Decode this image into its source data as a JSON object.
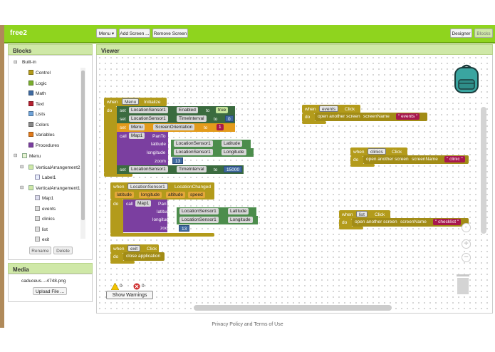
{
  "project": {
    "name": "free2"
  },
  "toolbar": {
    "screen_select": "Menu ▾",
    "add_screen": "Add Screen ...",
    "remove_screen": "Remove Screen",
    "designer": "Designer",
    "blocks": "Blocks"
  },
  "blocks_panel": {
    "title": "Blocks",
    "builtin": "Built-in",
    "categories": [
      {
        "label": "Control",
        "color": "#b39b1b"
      },
      {
        "label": "Logic",
        "color": "#7aad2e"
      },
      {
        "label": "Math",
        "color": "#3f6aa0"
      },
      {
        "label": "Text",
        "color": "#b52030"
      },
      {
        "label": "Lists",
        "color": "#6fa3d8"
      },
      {
        "label": "Colors",
        "color": "#888888"
      },
      {
        "label": "Variables",
        "color": "#e07a1b"
      },
      {
        "label": "Procedures",
        "color": "#7b3fa0"
      }
    ],
    "screen": "Menu",
    "components": [
      "VerticalArrangement2",
      "Label1",
      "VerticalArrangement1",
      "Map1",
      "events",
      "clinics",
      "list",
      "exit"
    ],
    "rename": "Rename",
    "delete": "Delete"
  },
  "media": {
    "title": "Media",
    "file": "caduceus...-4748.png",
    "upload": "Upload File ..."
  },
  "viewer": {
    "title": "Viewer"
  },
  "blocks": {
    "when": "when",
    "do": "do",
    "set": "set",
    "to": "to",
    "call": "call",
    "menu": "Menu",
    "initialize": "Initialize",
    "loc": "LocationSensor1",
    "enabled": "Enabled",
    "true": "true",
    "timeinterval": "TimeInterval",
    "zero": "0",
    "screen_orient": "ScreenOrientation",
    "one": "1",
    "map": "Map1",
    "panto": "PanTo",
    "latitude": "latitude",
    "longitude": "longitude",
    "zoom": "zoom",
    "Latitude": "Latitude",
    "Longitude": "Longitude",
    "thirteen": "13",
    "fifteen_k": "15000",
    "loc_changed": "LocationChanged",
    "altitude": "altitude",
    "speed": "speed",
    "events": "events",
    "click": "Click",
    "open_screen": "open another screen",
    "screen_name": "screenName",
    "clinics": "clinics",
    "clinic": "clinic",
    "list": "list",
    "checklist": "checklist",
    "exit": "exit",
    "close_app": "close application"
  },
  "warnings": {
    "warn_count": "0",
    "err_count": "0",
    "show": "Show Warnings"
  },
  "footer": "Privacy Policy and Terms of Use"
}
